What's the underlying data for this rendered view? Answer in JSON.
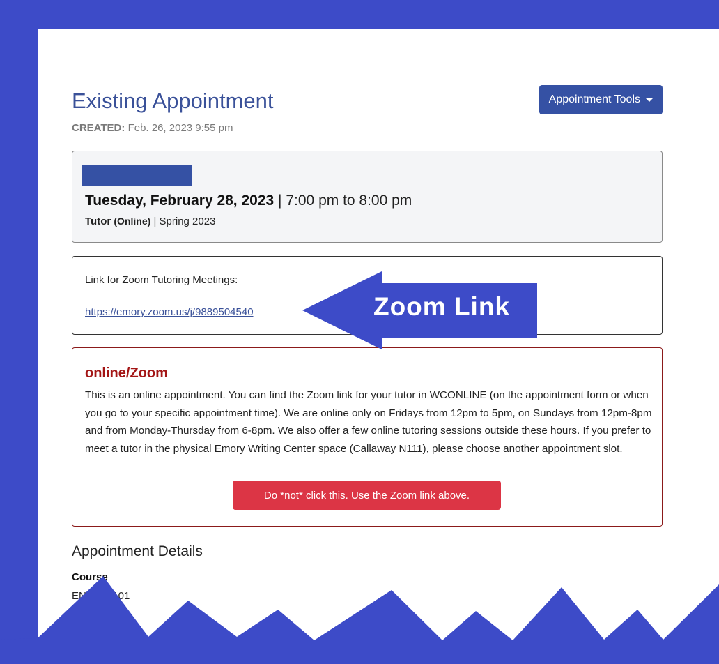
{
  "header": {
    "title": "Existing Appointment",
    "tools_button": "Appointment Tools",
    "created_label": "CREATED:",
    "created_value": "Feb. 26, 2023 9:55 pm"
  },
  "appointment": {
    "date": "Tuesday, February 28, 2023",
    "separator": "|",
    "time": "7:00 pm to 8:00 pm",
    "role": "Tutor",
    "mode": "(Online)",
    "term": "Spring 2023"
  },
  "zoom": {
    "label": "Link for Zoom Tutoring Meetings:",
    "url": "https://emory.zoom.us/j/9889504540",
    "annotation": "Zoom Link"
  },
  "notice": {
    "title": "online/Zoom",
    "body": "This is an online appointment. You can find the Zoom link for your tutor in WCONLINE (on the appointment form or when you go to your specific appointment time). We are online only on Fridays from 12pm to 5pm, on Sundays from 12pm-8pm and from Monday-Thursday from 6-8pm. We also offer a few online tutoring sessions outside these hours. If you prefer to meet a tutor in the physical Emory Writing Center space (Callaway N111), please choose another appointment slot.",
    "button": "Do *not* click this. Use the Zoom link above."
  },
  "details": {
    "heading": "Appointment Details",
    "course_label": "Course",
    "course_value": "ENGRD 101"
  },
  "colors": {
    "frame": "#3d4bc8",
    "brand": "#3551a4",
    "notice_title": "#a31515",
    "danger": "#dc3545"
  }
}
